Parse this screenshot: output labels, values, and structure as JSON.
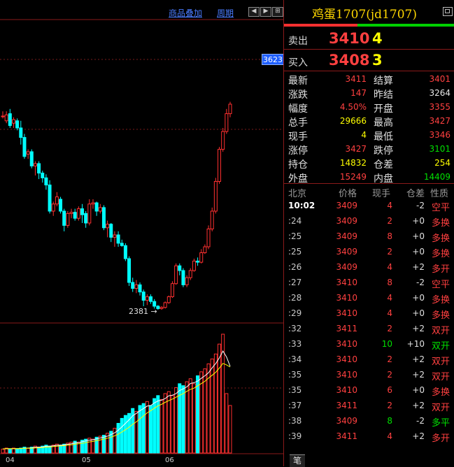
{
  "toolbar": {
    "overlay_label": "商品叠加",
    "period_label": "周期",
    "nav_left": "◀",
    "nav_right": "▶",
    "nav_pause": "⊞"
  },
  "chart": {
    "current_price_tag": "3623",
    "low_label": "2381",
    "x_ticks": [
      "04",
      "05",
      "06"
    ]
  },
  "colors": {
    "up": "#ff3030",
    "down": "#00ffff",
    "ma1": "#ffffff",
    "ma2": "#ffff00"
  },
  "chart_data": {
    "type": "candlestick",
    "title": "",
    "x_ticks": [
      "04",
      "05",
      "06"
    ],
    "annotations": [
      "2381",
      "3623"
    ],
    "candles": [
      [
        3000,
        3000,
        3040,
        2980
      ],
      [
        2960,
        3010,
        3040,
        2940
      ],
      [
        3020,
        2920,
        3060,
        2900
      ],
      [
        2940,
        2970,
        2990,
        2900
      ],
      [
        2960,
        2900,
        2980,
        2880
      ],
      [
        2900,
        2820,
        2960,
        2760
      ],
      [
        2820,
        2660,
        2850,
        2640
      ],
      [
        2680,
        2700,
        2720,
        2640
      ],
      [
        2700,
        2580,
        2720,
        2560
      ],
      [
        2580,
        2600,
        2620,
        2500
      ],
      [
        2600,
        2520,
        2620,
        2470
      ],
      [
        2520,
        2480,
        2540,
        2440
      ],
      [
        2480,
        2420,
        2510,
        2380
      ],
      [
        2420,
        2200,
        2460,
        2180
      ],
      [
        2200,
        2260,
        2280,
        2160
      ],
      [
        2260,
        2320,
        2360,
        2240
      ],
      [
        2300,
        2200,
        2320,
        2180
      ],
      [
        2200,
        2080,
        2220,
        2030
      ],
      [
        2080,
        2180,
        2200,
        2060
      ],
      [
        2180,
        2190,
        2220,
        2140
      ],
      [
        2190,
        2140,
        2220,
        2120
      ],
      [
        2140,
        2220,
        2240,
        2120
      ],
      [
        2220,
        2170,
        2260,
        2100
      ],
      [
        2180,
        2100,
        2200,
        2060
      ],
      [
        2100,
        2260,
        2300,
        2080
      ],
      [
        2260,
        2270,
        2300,
        2220
      ],
      [
        2270,
        2200,
        2280,
        2160
      ],
      [
        2200,
        2230,
        2260,
        2180
      ],
      [
        2230,
        2060,
        2250,
        2040
      ],
      [
        2060,
        2090,
        2120,
        1980
      ],
      [
        2090,
        1980,
        2100,
        1940
      ],
      [
        1980,
        2000,
        2030,
        1900
      ],
      [
        2000,
        1930,
        2030,
        1900
      ],
      [
        1930,
        1910,
        1960,
        1900
      ],
      [
        1910,
        1800,
        1930,
        1780
      ],
      [
        1800,
        1600,
        1820,
        1570
      ],
      [
        1600,
        1550,
        1640,
        1520
      ],
      [
        1550,
        1580,
        1620,
        1510
      ],
      [
        1580,
        1520,
        1600,
        1490
      ],
      [
        1520,
        1450,
        1540,
        1400
      ],
      [
        1450,
        1480,
        1500,
        1410
      ],
      [
        1480,
        1440,
        1500,
        1420
      ],
      [
        1440,
        1400,
        1460,
        1380
      ],
      [
        1400,
        1380,
        1410,
        1370
      ],
      [
        1380,
        1390,
        1400,
        1370
      ],
      [
        1390,
        1430,
        1440,
        1380
      ],
      [
        1430,
        1480,
        1490,
        1420
      ],
      [
        1480,
        1590,
        1610,
        1470
      ],
      [
        1590,
        1740,
        1760,
        1580
      ],
      [
        1740,
        1700,
        1760,
        1660
      ],
      [
        1700,
        1580,
        1720,
        1560
      ],
      [
        1580,
        1640,
        1660,
        1560
      ],
      [
        1640,
        1700,
        1720,
        1620
      ],
      [
        1700,
        1780,
        1800,
        1690
      ],
      [
        1780,
        1770,
        1810,
        1740
      ],
      [
        1770,
        1850,
        1880,
        1760
      ],
      [
        1850,
        1900,
        1920,
        1840
      ],
      [
        1900,
        2050,
        2080,
        1880
      ],
      [
        2050,
        2200,
        2230,
        2030
      ],
      [
        2200,
        2450,
        2480,
        2180
      ],
      [
        2450,
        2720,
        2740,
        2430
      ],
      [
        2720,
        2870,
        2900,
        2700
      ],
      [
        2870,
        3020,
        3060,
        2850
      ],
      [
        3020,
        3100,
        3120,
        2990
      ]
    ],
    "volume": [
      4,
      5,
      4,
      5,
      4,
      5,
      6,
      5,
      6,
      7,
      6,
      7,
      8,
      7,
      8,
      9,
      8,
      9,
      10,
      11,
      12,
      11,
      13,
      14,
      15,
      14,
      16,
      17,
      18,
      20,
      22,
      25,
      30,
      35,
      38,
      40,
      45,
      42,
      48,
      50,
      52,
      48,
      55,
      58,
      54,
      60,
      62,
      58,
      66,
      70,
      68,
      72,
      75,
      70,
      78,
      82,
      85,
      90,
      95,
      100,
      110,
      120,
      60,
      48
    ],
    "ma": {
      "white": true,
      "yellow": true
    }
  },
  "panel": {
    "title": "鸡蛋1707(jd1707)",
    "sell": {
      "label": "卖出",
      "price": "3410",
      "vol": "4"
    },
    "buy": {
      "label": "买入",
      "price": "3408",
      "vol": "3"
    },
    "stats_left": [
      {
        "k": "最新",
        "v": "3411",
        "c": "#ff4040"
      },
      {
        "k": "涨跌",
        "v": "147",
        "c": "#ff4040"
      },
      {
        "k": "幅度",
        "v": "4.50%",
        "c": "#ff4040"
      },
      {
        "k": "总手",
        "v": "29666",
        "c": "#ffff00"
      },
      {
        "k": "现手",
        "v": "4",
        "c": "#ffff00"
      },
      {
        "k": "涨停",
        "v": "3427",
        "c": "#ff4040"
      },
      {
        "k": "持仓",
        "v": "14832",
        "c": "#ffff00"
      },
      {
        "k": "外盘",
        "v": "15249",
        "c": "#ff4040"
      }
    ],
    "stats_right": [
      {
        "k": "结算",
        "v": "3401",
        "c": "#ff4040"
      },
      {
        "k": "昨结",
        "v": "3264",
        "c": "#e8e8e8"
      },
      {
        "k": "开盘",
        "v": "3355",
        "c": "#ff4040"
      },
      {
        "k": "最高",
        "v": "3427",
        "c": "#ff4040"
      },
      {
        "k": "最低",
        "v": "3346",
        "c": "#ff4040"
      },
      {
        "k": "跌停",
        "v": "3101",
        "c": "#00e000"
      },
      {
        "k": "仓差",
        "v": "254",
        "c": "#ffff00"
      },
      {
        "k": "内盘",
        "v": "14409",
        "c": "#00e000"
      }
    ],
    "tick_header": [
      "北京",
      "价格",
      "现手",
      "仓差",
      "性质"
    ],
    "ticks": [
      {
        "t": "10:02",
        "p": "3409",
        "v": "4",
        "vc": "#ff4040",
        "d": "-2",
        "n": "空平",
        "nc": "#ff4040"
      },
      {
        "t": ":24",
        "p": "3409",
        "v": "2",
        "vc": "#ff4040",
        "d": "+0",
        "n": "多换",
        "nc": "#ff4040"
      },
      {
        "t": ":25",
        "p": "3409",
        "v": "8",
        "vc": "#ff4040",
        "d": "+0",
        "n": "多换",
        "nc": "#ff4040"
      },
      {
        "t": ":25",
        "p": "3409",
        "v": "2",
        "vc": "#ff4040",
        "d": "+0",
        "n": "多换",
        "nc": "#ff4040"
      },
      {
        "t": ":26",
        "p": "3409",
        "v": "4",
        "vc": "#ff4040",
        "d": "+2",
        "n": "多开",
        "nc": "#ff4040"
      },
      {
        "t": ":27",
        "p": "3410",
        "v": "8",
        "vc": "#ff4040",
        "d": "-2",
        "n": "空平",
        "nc": "#ff4040"
      },
      {
        "t": ":28",
        "p": "3410",
        "v": "4",
        "vc": "#ff4040",
        "d": "+0",
        "n": "多换",
        "nc": "#ff4040"
      },
      {
        "t": ":29",
        "p": "3410",
        "v": "4",
        "vc": "#ff4040",
        "d": "+0",
        "n": "多换",
        "nc": "#ff4040"
      },
      {
        "t": ":32",
        "p": "3411",
        "v": "2",
        "vc": "#ff4040",
        "d": "+2",
        "n": "双开",
        "nc": "#ff4040"
      },
      {
        "t": ":33",
        "p": "3410",
        "v": "10",
        "vc": "#00e000",
        "d": "+10",
        "n": "双开",
        "nc": "#00e000"
      },
      {
        "t": ":34",
        "p": "3410",
        "v": "2",
        "vc": "#ff4040",
        "d": "+2",
        "n": "双开",
        "nc": "#ff4040"
      },
      {
        "t": ":35",
        "p": "3410",
        "v": "2",
        "vc": "#ff4040",
        "d": "+2",
        "n": "双开",
        "nc": "#ff4040"
      },
      {
        "t": ":35",
        "p": "3410",
        "v": "6",
        "vc": "#ff4040",
        "d": "+0",
        "n": "多换",
        "nc": "#ff4040"
      },
      {
        "t": ":37",
        "p": "3411",
        "v": "2",
        "vc": "#ff4040",
        "d": "+2",
        "n": "双开",
        "nc": "#ff4040"
      },
      {
        "t": ":38",
        "p": "3409",
        "v": "8",
        "vc": "#00e000",
        "d": "-2",
        "n": "多平",
        "nc": "#00e000"
      },
      {
        "t": ":39",
        "p": "3411",
        "v": "4",
        "vc": "#ff4040",
        "d": "+2",
        "n": "多开",
        "nc": "#ff4040"
      }
    ],
    "tab_label": "笔"
  }
}
